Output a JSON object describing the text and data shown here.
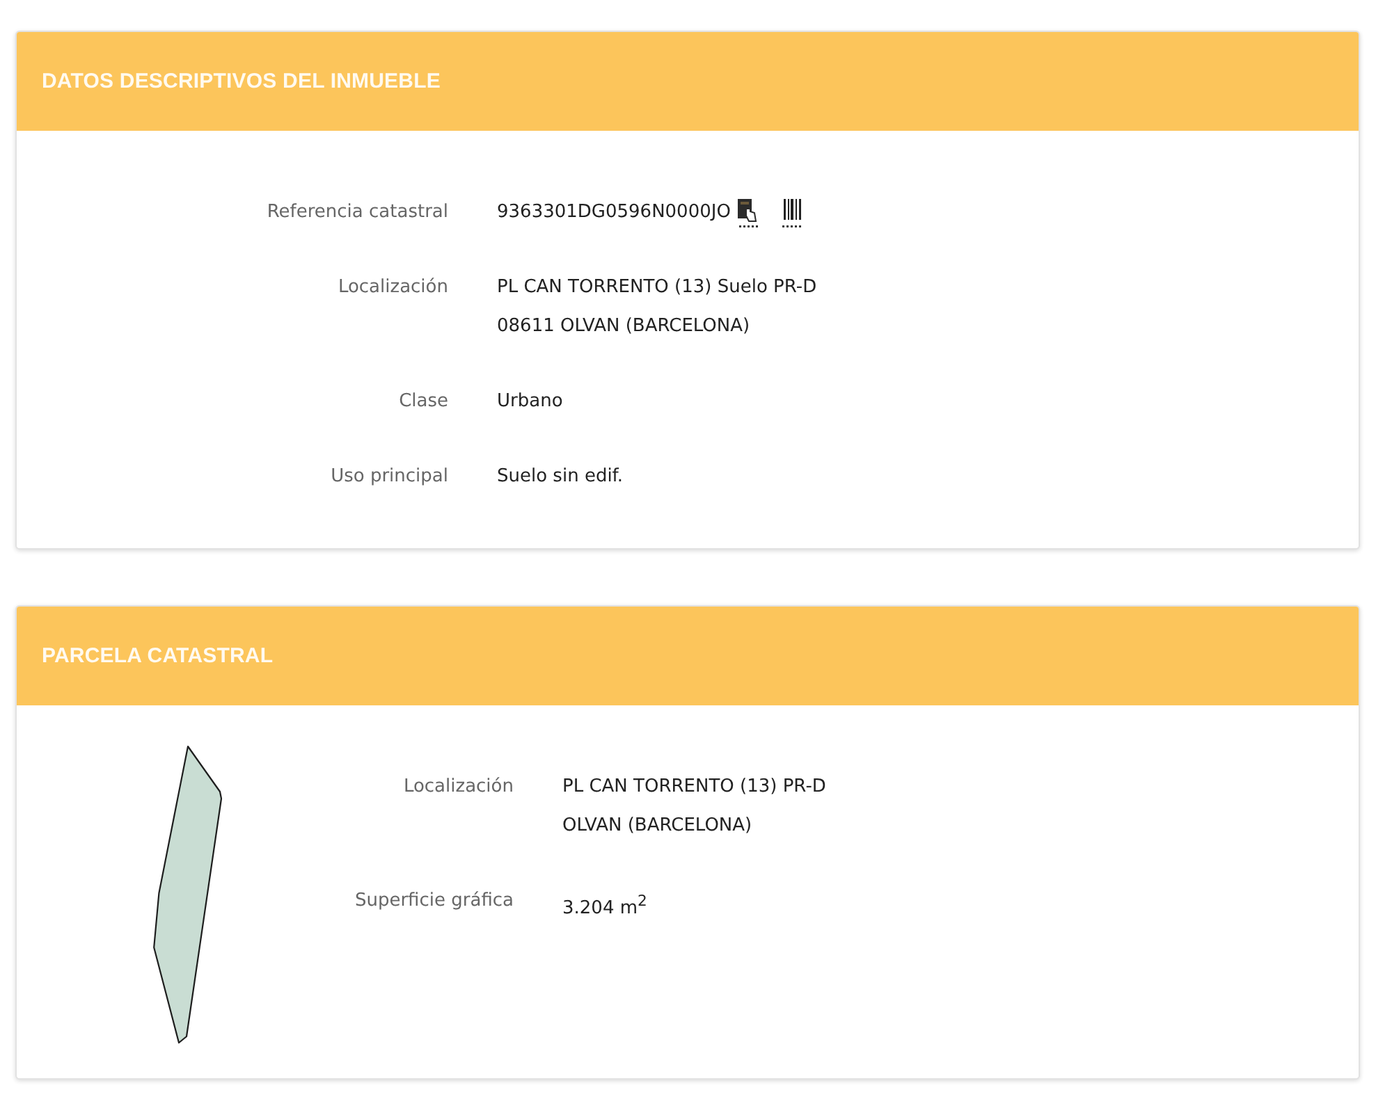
{
  "sections": [
    {
      "kind": "details",
      "title": "DATOS DESCRIPTIVOS DEL INMUEBLE",
      "fields": [
        {
          "kind": "reference",
          "label": "Referencia catastral",
          "value": [
            "9363301DG0596N0000JO"
          ]
        },
        {
          "kind": "text",
          "label": "Localización",
          "value": [
            "PL CAN TORRENTO (13) Suelo PR-D",
            "08611 OLVAN (BARCELONA)"
          ]
        },
        {
          "kind": "text",
          "label": "Clase",
          "value": [
            "Urbano"
          ]
        },
        {
          "kind": "text",
          "label": "Uso principal",
          "value": [
            "Suelo sin edif."
          ]
        }
      ]
    },
    {
      "kind": "parcel",
      "title": "PARCELA CATASTRAL",
      "fields": [
        {
          "kind": "text",
          "label": "Localización",
          "value": [
            "PL CAN TORRENTO (13) PR-D",
            "OLVAN (BARCELONA)"
          ]
        },
        {
          "kind": "text",
          "label": "Superficie gráfica",
          "value": [
            "3.204 m$^{2}$"
          ]
        }
      ]
    }
  ]
}
